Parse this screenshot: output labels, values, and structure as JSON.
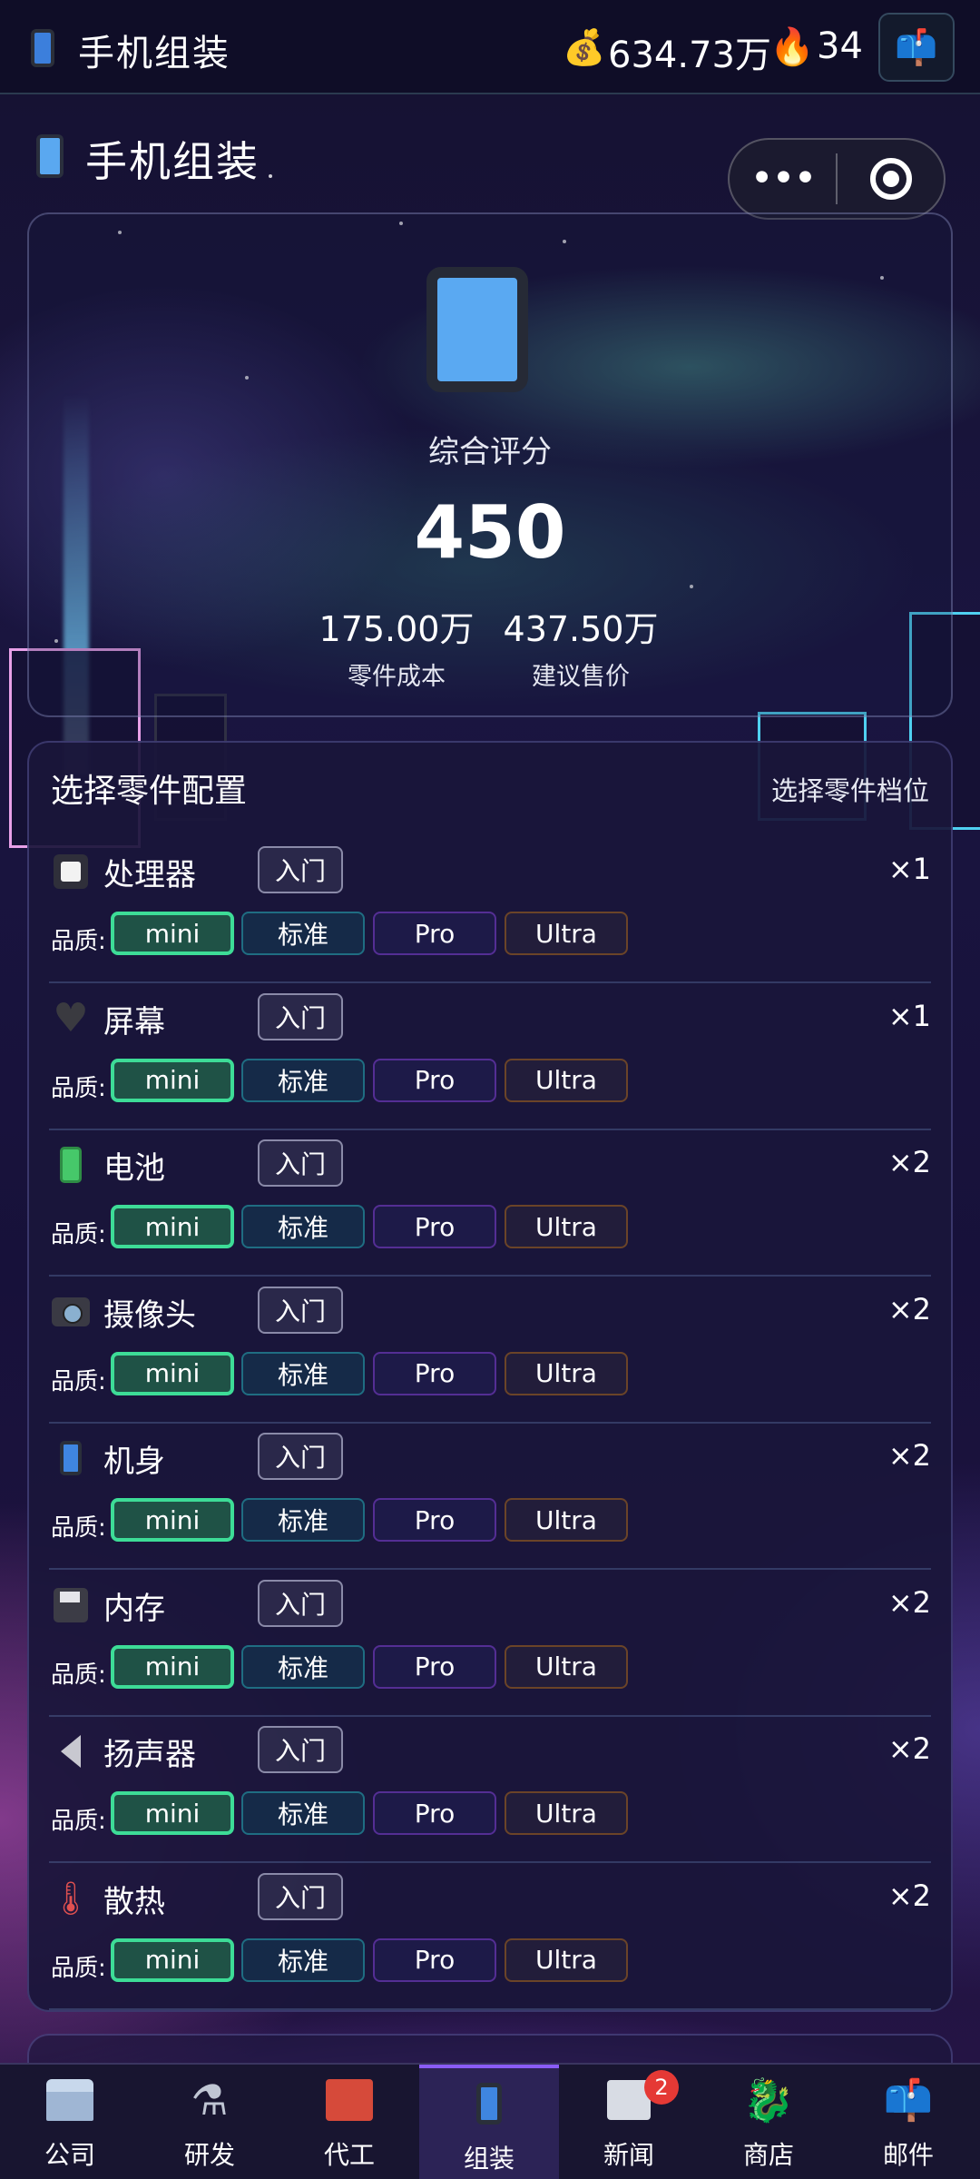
{
  "topbar": {
    "title": "手机组装",
    "money_icon": "💰",
    "money": "634.73万",
    "fire_icon": "🔥",
    "fire_value": "34",
    "mail_icon": "📫"
  },
  "page": {
    "title": "手机组装"
  },
  "score": {
    "label": "综合评分",
    "value": "450",
    "cost_value": "175.00万",
    "cost_label": "零件成本",
    "price_value": "437.50万",
    "price_label": "建议售价"
  },
  "panel": {
    "title": "选择零件配置",
    "subtitle": "选择零件档位",
    "quality_label": "品质:",
    "tier_label": "入门",
    "chips": [
      "mini",
      "标准",
      "Pro",
      "Ultra"
    ],
    "selected_chip": "mini",
    "parts": [
      {
        "name": "处理器",
        "icon": "cpu-icon",
        "qty": "×1"
      },
      {
        "name": "屏幕",
        "icon": "heart-icon",
        "qty": "×1"
      },
      {
        "name": "电池",
        "icon": "battery-icon",
        "qty": "×2"
      },
      {
        "name": "摄像头",
        "icon": "camera-icon",
        "qty": "×2"
      },
      {
        "name": "机身",
        "icon": "phone-icon",
        "qty": "×2"
      },
      {
        "name": "内存",
        "icon": "floppy-disk-icon",
        "qty": "×2"
      },
      {
        "name": "扬声器",
        "icon": "speaker-icon",
        "qty": "×2"
      },
      {
        "name": "散热",
        "icon": "thermometer-icon",
        "qty": "×2"
      }
    ]
  },
  "nav": {
    "items": [
      {
        "label": "公司",
        "icon": "bank-icon"
      },
      {
        "label": "研发",
        "icon": "microscope-icon"
      },
      {
        "label": "代工",
        "icon": "factory-icon"
      },
      {
        "label": "组装",
        "icon": "phone-icon",
        "active": true
      },
      {
        "label": "新闻",
        "icon": "newspaper-icon",
        "badge": "2"
      },
      {
        "label": "商店",
        "icon": "dragon-icon"
      },
      {
        "label": "邮件",
        "icon": "mailbox-icon"
      }
    ]
  },
  "colors": {
    "selected_chip_border": "#3ddc97",
    "nav_active_accent": "#8a5cf6",
    "badge": "#e53935"
  }
}
